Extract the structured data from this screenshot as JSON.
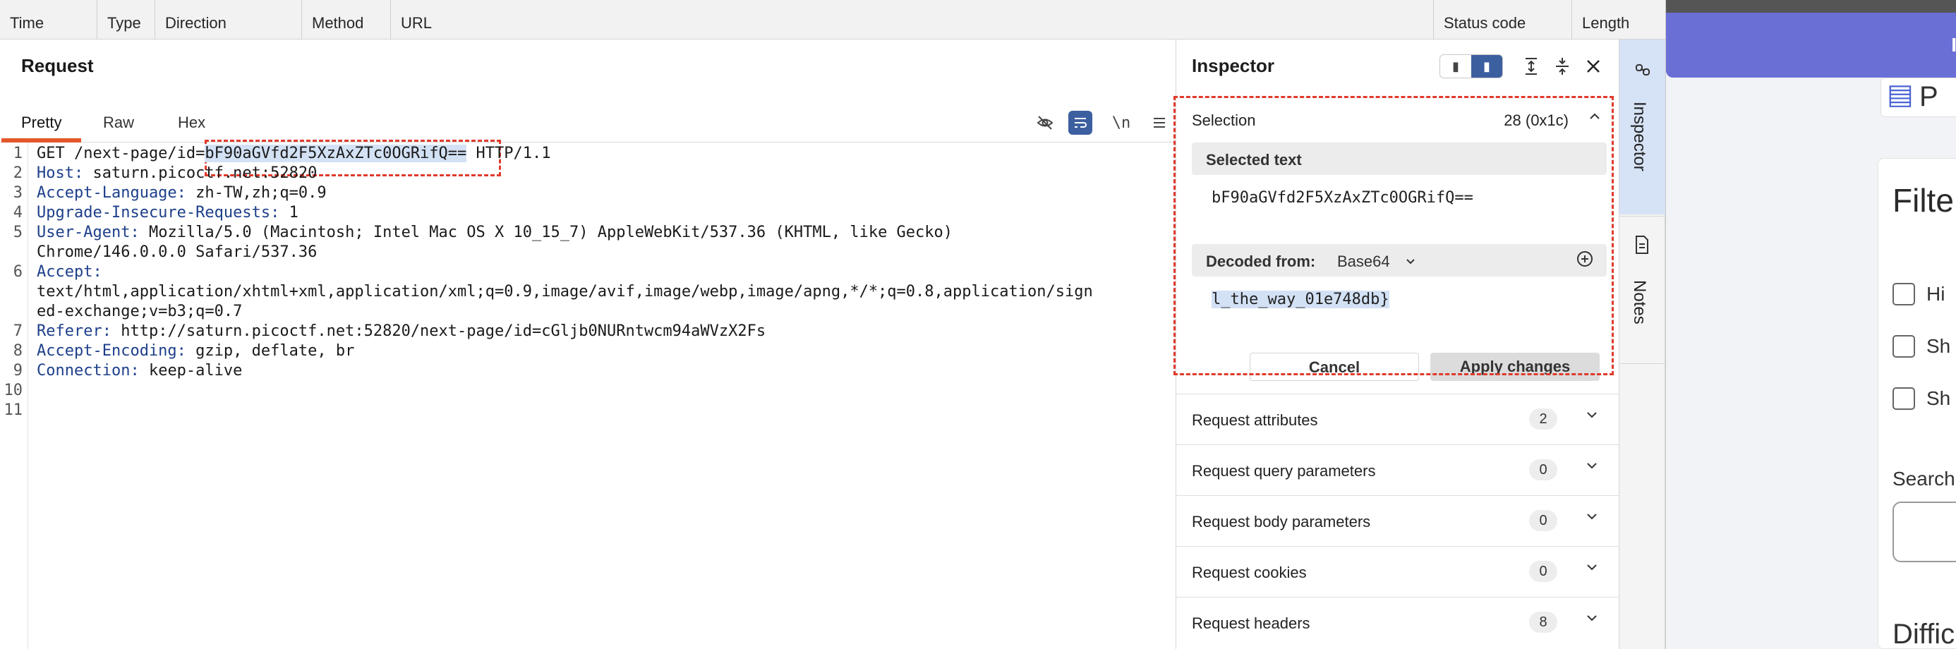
{
  "table_header": {
    "columns": [
      "Time",
      "Type",
      "Direction",
      "Method",
      "URL",
      "Status code",
      "Length"
    ]
  },
  "request": {
    "title": "Request",
    "tabs": [
      "Pretty",
      "Raw",
      "Hex"
    ],
    "active_tab": "Pretty",
    "tools": {
      "hide_icon": "eye-slash-icon",
      "wrap_icon": "wrap-lines-icon",
      "newline_label": "\\n",
      "menu_icon": "hamburger-menu-icon"
    },
    "lines": [
      {
        "n": "1",
        "key": "GET /next-page/id=",
        "sel": "bF90aGVfd2F5XzAxZTc0OGRifQ==",
        "rest": " HTTP/1.1"
      },
      {
        "n": "2",
        "key": "Host:",
        "rest": " saturn.picoctf.net:52820"
      },
      {
        "n": "3",
        "key": "Accept-Language:",
        "rest": " zh-TW,zh;q=0.9"
      },
      {
        "n": "4",
        "key": "Upgrade-Insecure-Requests:",
        "rest": " 1"
      },
      {
        "n": "5",
        "key": "User-Agent:",
        "rest": " Mozilla/5.0 (Macintosh; Intel Mac OS X 10_15_7) AppleWebKit/537.36 (KHTML, like Gecko)"
      },
      {
        "n": "",
        "key": "",
        "rest": "Chrome/146.0.0.0 Safari/537.36"
      },
      {
        "n": "6",
        "key": "Accept:",
        "rest": ""
      },
      {
        "n": "",
        "key": "",
        "rest": "text/html,application/xhtml+xml,application/xml;q=0.9,image/avif,image/webp,image/apng,*/*;q=0.8,application/sign"
      },
      {
        "n": "",
        "key": "",
        "rest": "ed-exchange;v=b3;q=0.7"
      },
      {
        "n": "7",
        "key": "Referer:",
        "rest": " http://saturn.picoctf.net:52820/next-page/id=cGljb0NURntwcm94aWVzX2Fs"
      },
      {
        "n": "8",
        "key": "Accept-Encoding:",
        "rest": " gzip, deflate, br"
      },
      {
        "n": "9",
        "key": "Connection:",
        "rest": " keep-alive"
      },
      {
        "n": "10",
        "key": "",
        "rest": ""
      },
      {
        "n": "11",
        "key": "",
        "rest": ""
      }
    ]
  },
  "inspector": {
    "title": "Inspector",
    "selection": {
      "label": "Selection",
      "count": "28 (0x1c)",
      "selected_text_label": "Selected text",
      "selected_text": "bF90aGVfd2F5XzAxZTc0OGRifQ==",
      "decoded_from_label": "Decoded from:",
      "decoded_from_value": "Base64",
      "decoded_text": "l_the_way_01e748db}",
      "cancel_label": "Cancel",
      "apply_label": "Apply changes"
    },
    "sections": [
      {
        "label": "Request attributes",
        "count": "2"
      },
      {
        "label": "Request query parameters",
        "count": "0"
      },
      {
        "label": "Request body parameters",
        "count": "0"
      },
      {
        "label": "Request cookies",
        "count": "0"
      },
      {
        "label": "Request headers",
        "count": "8"
      }
    ]
  },
  "side_tabs": [
    "Inspector",
    "Notes"
  ],
  "browser": {
    "bar_char": "I",
    "card_char": "P",
    "filter_title": "Filte",
    "checkboxes": [
      "Hi",
      "Sh",
      "Sh"
    ],
    "search_label": "Search",
    "difficulty_label": "Diffic"
  },
  "colors": {
    "accent": "#3c5fa0",
    "tab_underline": "#e3572b",
    "highlight_box": "#e03a2c",
    "selection_bg": "#d3e1f5",
    "header_key": "#1d3f8a",
    "browser_bar": "#6a6fd6"
  }
}
